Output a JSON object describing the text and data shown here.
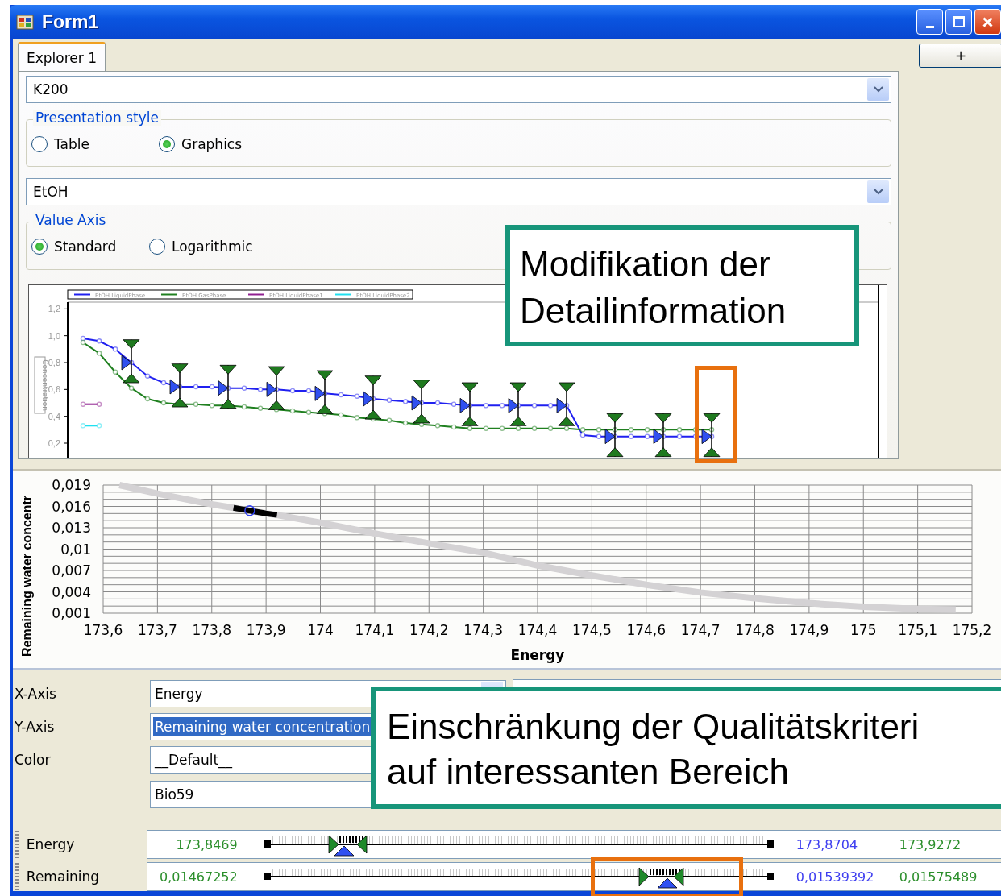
{
  "window": {
    "title": "Form1"
  },
  "tabs": [
    {
      "label": "Explorer 1",
      "selected": true
    }
  ],
  "add_button": {
    "label": "+"
  },
  "explorer": {
    "dataset_combo": {
      "value": "K200"
    },
    "presentation_style": {
      "title": "Presentation style",
      "options": [
        {
          "label": "Table",
          "selected": false
        },
        {
          "label": "Graphics",
          "selected": true
        }
      ]
    },
    "component_combo": {
      "value": "EtOH"
    },
    "value_axis": {
      "title": "Value Axis",
      "options": [
        {
          "label": "Standard",
          "selected": true
        },
        {
          "label": "Logarithmic",
          "selected": false
        }
      ]
    },
    "chart_data": {
      "type": "line",
      "ylabel": "Concentration",
      "legend": "top",
      "ylim": [
        0.08,
        1.25
      ],
      "yticks": [
        {
          "value": 0.2,
          "label": "0,2"
        },
        {
          "value": 0.4,
          "label": "0,4"
        },
        {
          "value": 0.6,
          "label": "0,6"
        },
        {
          "value": 0.8,
          "label": "0,8"
        },
        {
          "value": 1.0,
          "label": "1,0"
        },
        {
          "value": 1.2,
          "label": "1,2"
        }
      ],
      "categories": [
        null,
        null,
        null,
        null,
        null,
        null,
        null,
        null,
        null,
        null,
        null,
        null,
        null,
        null,
        null,
        null,
        null,
        null,
        null,
        null,
        null,
        null,
        null,
        null,
        null,
        null,
        null,
        null,
        null,
        null,
        null,
        null,
        null,
        null,
        null,
        null,
        null,
        null,
        null,
        null
      ],
      "series": [
        {
          "name": "EtOH LiquidPhase",
          "color": "#2020f0",
          "values": [
            0.98,
            0.96,
            0.9,
            0.8,
            0.7,
            0.65,
            0.62,
            0.62,
            0.62,
            0.61,
            0.61,
            0.6,
            0.6,
            0.59,
            0.59,
            0.57,
            0.56,
            0.55,
            0.53,
            0.52,
            0.51,
            0.5,
            0.5,
            0.49,
            0.48,
            0.48,
            0.48,
            0.48,
            0.48,
            0.48,
            0.48,
            0.26,
            0.25,
            0.25,
            0.25,
            0.25,
            0.25,
            0.25,
            0.25,
            0.25
          ]
        },
        {
          "name": "EtOH GasPhase",
          "color": "#208020",
          "values": [
            0.95,
            0.87,
            0.73,
            0.61,
            0.53,
            0.5,
            0.49,
            0.49,
            0.48,
            0.48,
            0.47,
            0.46,
            0.45,
            0.44,
            0.43,
            0.42,
            0.41,
            0.39,
            0.38,
            0.37,
            0.35,
            0.34,
            0.33,
            0.32,
            0.31,
            0.31,
            0.31,
            0.31,
            0.31,
            0.31,
            0.31,
            0.3,
            0.3,
            0.3,
            0.3,
            0.3,
            0.3,
            0.3,
            0.3,
            0.3
          ]
        },
        {
          "name": "EtOH LiquidPhase1",
          "color": "#902090",
          "values": [
            0.49,
            0.49,
            null,
            null,
            null,
            null,
            null,
            null,
            null,
            null,
            null,
            null,
            null,
            null,
            null,
            null,
            null,
            null,
            null,
            null,
            null,
            null,
            null,
            null,
            null,
            null,
            null,
            null,
            null,
            null,
            null,
            null,
            null,
            null,
            null,
            null,
            null,
            null,
            null,
            null
          ]
        },
        {
          "name": "EtOH LiquidPhase2",
          "color": "#20e0f0",
          "values": [
            0.33,
            0.33,
            null,
            null,
            null,
            null,
            null,
            null,
            null,
            null,
            null,
            null,
            null,
            null,
            null,
            null,
            null,
            null,
            null,
            null,
            null,
            null,
            null,
            null,
            null,
            null,
            null,
            null,
            null,
            null,
            null,
            null,
            null,
            null,
            null,
            null,
            null,
            null,
            null,
            null
          ]
        }
      ]
    }
  },
  "scatter_chart": {
    "chart_data": {
      "type": "line",
      "xlabel": "Energy",
      "ylabel": "Remaining water concentr",
      "grid": true,
      "xlim": [
        173.6,
        175.2
      ],
      "ylim": [
        0.001,
        0.019
      ],
      "xticks": [
        {
          "value": 173.6,
          "label": "173,6"
        },
        {
          "value": 173.7,
          "label": "173,7"
        },
        {
          "value": 173.8,
          "label": "173,8"
        },
        {
          "value": 173.9,
          "label": "173,9"
        },
        {
          "value": 174,
          "label": "174"
        },
        {
          "value": 174.1,
          "label": "174,1"
        },
        {
          "value": 174.2,
          "label": "174,2"
        },
        {
          "value": 174.3,
          "label": "174,3"
        },
        {
          "value": 174.4,
          "label": "174,4"
        },
        {
          "value": 174.5,
          "label": "174,5"
        },
        {
          "value": 174.6,
          "label": "174,6"
        },
        {
          "value": 174.7,
          "label": "174,7"
        },
        {
          "value": 174.8,
          "label": "174,8"
        },
        {
          "value": 174.9,
          "label": "174,9"
        },
        {
          "value": 175,
          "label": "175"
        },
        {
          "value": 175.1,
          "label": "175,1"
        },
        {
          "value": 175.2,
          "label": "175,2"
        }
      ],
      "yticks": [
        {
          "value": 0.001,
          "label": "0,001"
        },
        {
          "value": 0.004,
          "label": "0,004"
        },
        {
          "value": 0.007,
          "label": "0,007"
        },
        {
          "value": 0.01,
          "label": "0,01"
        },
        {
          "value": 0.013,
          "label": "0,013"
        },
        {
          "value": 0.016,
          "label": "0,016"
        },
        {
          "value": 0.019,
          "label": "0,019"
        }
      ],
      "x": [
        173.63,
        173.7,
        173.8,
        173.84,
        173.87,
        173.9,
        173.92,
        174.0,
        174.1,
        174.2,
        174.3,
        174.4,
        174.5,
        174.6,
        174.7,
        174.8,
        174.9,
        175.0,
        175.1,
        175.17
      ],
      "series": [
        {
          "color": "#d4d2d4",
          "values": [
            0.019,
            0.0178,
            0.0163,
            0.0158,
            0.0154,
            0.015,
            0.0148,
            0.0137,
            0.0122,
            0.0108,
            0.0095,
            0.0077,
            0.0063,
            0.005,
            0.0039,
            0.0031,
            0.0024,
            0.0019,
            0.0016,
            0.0015
          ]
        },
        {
          "color": "#000000",
          "values": [
            null,
            null,
            null,
            0.0158,
            0.0154,
            0.015,
            0.0148,
            null,
            null,
            null,
            null,
            null,
            null,
            null,
            null,
            null,
            null,
            null,
            null,
            null
          ]
        }
      ]
    }
  },
  "axis_settings": [
    {
      "label": "X-Axis",
      "value": "Energy",
      "selected": false
    },
    {
      "label": "Y-Axis",
      "value": "Remaining water concentration",
      "selected": true
    },
    {
      "label": "Color",
      "value": "__Default__",
      "selected": false
    },
    {
      "value": "Bio59",
      "selected": false
    }
  ],
  "range_filters": [
    {
      "label": "Energy",
      "min": "173,8469",
      "current": "173,8704",
      "max": "173,9272",
      "thumbs": [
        {
          "kind": "low",
          "level": 0.135
        },
        {
          "kind": "high",
          "level": 0.19
        },
        {
          "kind": "value",
          "level": 0.155
        }
      ]
    },
    {
      "label": "Remaining",
      "min": "0,01467252",
      "current": "0,01539392",
      "max": "0,01575489",
      "thumbs": [
        {
          "kind": "low",
          "level": 0.747
        },
        {
          "kind": "high",
          "level": 0.815
        },
        {
          "kind": "value",
          "level": 0.793
        }
      ]
    }
  ],
  "callouts": [
    {
      "lines": [
        "Modifikation der",
        "Detailinformation"
      ]
    },
    {
      "lines": [
        "Einschränkung der Qualitätskriteri",
        "auf interessanten Bereich"
      ]
    }
  ]
}
